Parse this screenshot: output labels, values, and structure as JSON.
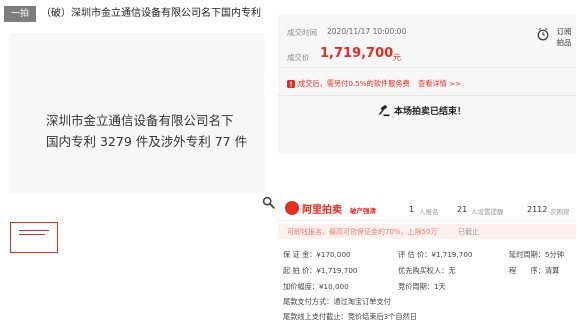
{
  "header": {
    "tag": "一拍",
    "title": "（破）深圳市金立通信设备有限公司名下国内专利"
  },
  "image": {
    "caption_line1": "深圳市金立通信设备有限公司名下",
    "caption_line2": "国内专利 3279 件及涉外专利 77 件"
  },
  "deal": {
    "time_label": "成交时间",
    "time_value": "2020/11/17 10:00:00",
    "price_label": "成交价",
    "price_value": "1,719,700",
    "price_unit": "元",
    "remind_label_1": "订阅",
    "remind_label_2": "拍品",
    "notice": "成交后，需另付0.5%的软件服务费",
    "notice_link": "查看详情 >>",
    "ended_text": "本场拍卖已结束！"
  },
  "brand": {
    "name": "阿里拍卖",
    "sub": "破产强清",
    "stats": [
      {
        "num": "1",
        "label": "人报名"
      },
      {
        "num": "21",
        "label": "人设置提醒"
      },
      {
        "num": "2112",
        "label": "次围观"
      }
    ]
  },
  "deposit": {
    "text": "可即钱报名，最高可贷保证金的70%，上限50万",
    "status": "已截止"
  },
  "details": {
    "deposit_label": "保 证 金：",
    "deposit_value": "¥170,000",
    "appraisal_label": "评 估 价：",
    "appraisal_value": "¥1,719,700",
    "delay_label": "延时周期：",
    "delay_value": "5分钟",
    "start_label": "起 拍 价：",
    "start_value": "¥1,719,700",
    "priority_label": "优先购买权人：",
    "priority_value": "无",
    "procedure_label": "程　　序：",
    "procedure_value": "清算",
    "increment_label": "加价幅度：",
    "increment_value": "¥10,000",
    "period_label": "竞价周期：",
    "period_value": "1天",
    "payment_label": "尾款支付方式：",
    "payment_value": "通过淘宝订单支付",
    "deadline_label": "尾款线上支付截止：",
    "deadline_value": "竞价结束后3个自然日"
  },
  "colors": {
    "accent": "#e02e24",
    "panel_bg": "#f7f7f7",
    "deposit_bg": "#fdf1ef"
  }
}
